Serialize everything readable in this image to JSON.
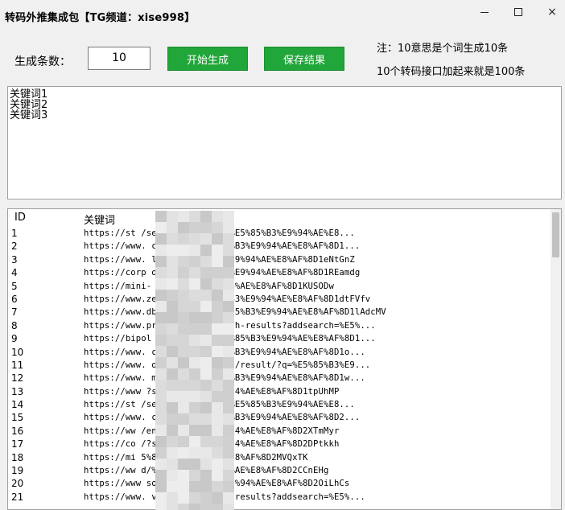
{
  "window": {
    "title": "转码外推集成包【TG频道：xise998】",
    "controls": {
      "minimize": "–",
      "maximize": "□",
      "close": "×"
    }
  },
  "form": {
    "count_label": "生成条数：",
    "count_value": "10",
    "start_button": "开始生成",
    "save_button": "保存结果",
    "note_line1": "注：10意思是个词生成10条",
    "note_line2": "10个转码接口加起来就是100条"
  },
  "keywords_text": [
    "关键词1",
    "关键词2",
    "关键词3"
  ],
  "results": {
    "columns": {
      "id": "ID",
      "keyword": "关键词"
    },
    "rows": [
      {
        "id": "1",
        "url": "https://st            /search/images?k=%E5%85%B3%E9%94%AE%E8..."
      },
      {
        "id": "2",
        "url": "https://www.           co.jp/?s=%E5%85%B3%E9%94%AE%E8%AF%8D1..."
      },
      {
        "id": "3",
        "url": "https://www.           l/en/%E5%85%B3%E9%94%AE%E8%AF%8D1eNtGnZ"
      },
      {
        "id": "4",
        "url": "https://corp           om/?s=%E5%85%B3%E9%94%AE%E8%AF%8D1REamdg"
      },
      {
        "id": "5",
        "url": "https://mini-          %E5%85%B3%E9%94%AE%E8%AF%8D1KUSODw"
      },
      {
        "id": "6",
        "url": "https://www.zedg       ind/%E5%85%B3%E9%94%AE%E8%AF%8D1dtFVfv"
      },
      {
        "id": "7",
        "url": "https://www.dbs        g/?soeg=%E5%85%B3%E9%94%AE%E8%AF%8D1lAdcMV"
      },
      {
        "id": "8",
        "url": "https://www.pr         view.com/search-results?addsearch=%E5%..."
      },
      {
        "id": "9",
        "url": "https://bipol          gen.no/sok/%E5%85%B3%E9%94%AE%E8%AF%8D1..."
      },
      {
        "id": "10",
        "url": "https://www.          cz/de/?s=%E5%85%B3%E9%94%AE%E8%AF%8D1o..."
      },
      {
        "id": "11",
        "url": "https://www.          om/catalogsearch/result/?q=%E5%85%B3%E9..."
      },
      {
        "id": "12",
        "url": "https://www.          m.net/?s=%E5%85%B3%E9%94%AE%E8%AF%8D1w..."
      },
      {
        "id": "13",
        "url": "https://www           ?s=%E5%85%B3%E9%94%AE%E8%AF%8D1tpUhMP"
      },
      {
        "id": "14",
        "url": "https://st            /search/images?k=%E5%85%B3%E9%94%AE%E8..."
      },
      {
        "id": "15",
        "url": "https://www.           co.jp/?s=%E5%85%B3%E9%94%AE%E8%AF%8D2..."
      },
      {
        "id": "16",
        "url": "https://ww            /en/%E5%85%B3%E9%94%AE%E8%AF%8D2XTmMyr"
      },
      {
        "id": "17",
        "url": "https://co            /?s=%E5%85%B3%E9%94%AE%E8%AF%8D2DPtkkh"
      },
      {
        "id": "18",
        "url": "https://mi            5%85%B3%E9%94%AE%E8%AF%8D2MVQxTK"
      },
      {
        "id": "19",
        "url": "https://ww            d/%E5%85%B3%E9%94%AE%E8%AF%8D2CCnEHg"
      },
      {
        "id": "20",
        "url": "https://www          soeg=%E5%85%B3%E9%94%AE%E8%AF%8D2OiLhCs"
      },
      {
        "id": "21",
        "url": "https://www.         view.com/search-results?addsearch=%E5%..."
      }
    ]
  },
  "colors": {
    "button_green": "#21a639",
    "window_bg": "#f0f0f0"
  }
}
